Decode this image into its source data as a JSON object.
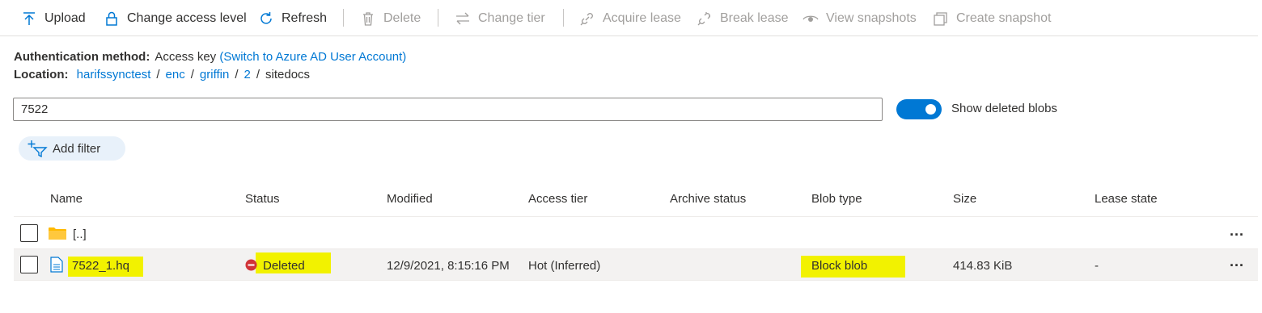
{
  "toolbar": {
    "upload": "Upload",
    "change_access": "Change access level",
    "refresh": "Refresh",
    "delete": "Delete",
    "change_tier": "Change tier",
    "acquire_lease": "Acquire lease",
    "break_lease": "Break lease",
    "view_snapshots": "View snapshots",
    "create_snapshot": "Create snapshot"
  },
  "auth": {
    "label": "Authentication method:",
    "value": "Access key",
    "switch_link": "(Switch to Azure AD User Account)"
  },
  "location": {
    "label": "Location:",
    "crumbs": [
      "harifssynctest",
      "enc",
      "griffin",
      "2",
      "sitedocs"
    ],
    "separator": "/"
  },
  "search": {
    "value": "7522"
  },
  "toggle": {
    "label": "Show deleted blobs",
    "on": true
  },
  "filter": {
    "label": "Add filter"
  },
  "table": {
    "columns": [
      "Name",
      "Status",
      "Modified",
      "Access tier",
      "Archive status",
      "Blob type",
      "Size",
      "Lease state"
    ],
    "rows": [
      {
        "name": "[..]",
        "status": "",
        "modified": "",
        "access_tier": "",
        "archive_status": "",
        "blob_type": "",
        "size": "",
        "lease_state": "",
        "more": "..."
      },
      {
        "name": "7522_1.hq",
        "status": "Deleted",
        "modified": "12/9/2021, 8:15:16 PM",
        "access_tier": "Hot (Inferred)",
        "archive_status": "",
        "blob_type": "Block blob",
        "size": "414.83 KiB",
        "lease_state": "-",
        "more": "..."
      }
    ]
  },
  "colors": {
    "accent": "#0078d4",
    "highlight": "#f2f200",
    "deleted_red": "#d13438",
    "folder": "#ffb900"
  }
}
